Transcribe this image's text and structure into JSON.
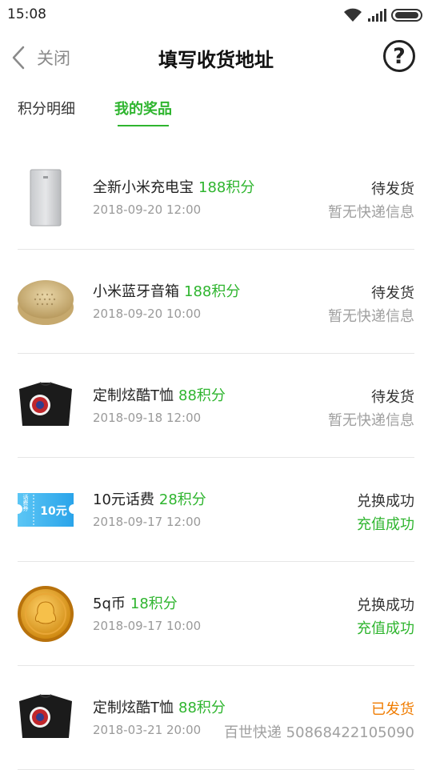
{
  "status_bar": {
    "time": "15:08"
  },
  "nav": {
    "back_label": "关闭",
    "title": "填写收货地址",
    "help_label": "?"
  },
  "tabs": [
    {
      "label": "积分明细"
    },
    {
      "label": "我的奖品"
    }
  ],
  "accent_color": "#2fb52f",
  "prizes": [
    {
      "name": "全新小米充电宝",
      "points": "188积分",
      "date": "2018-09-20 12:00",
      "status": "待发货",
      "detail": "暂无快递信息",
      "icon": "power-bank-icon"
    },
    {
      "name": "小米蓝牙音箱",
      "points": "188积分",
      "date": "2018-09-20 10:00",
      "status": "待发货",
      "detail": "暂无快递信息",
      "icon": "speaker-icon"
    },
    {
      "name": "定制炫酷T恤",
      "points": "88积分",
      "date": "2018-09-18 12:00",
      "status": "待发货",
      "detail": "暂无快递信息",
      "icon": "tshirt-icon"
    },
    {
      "name": "10元话费",
      "points": "28积分",
      "date": "2018-09-17 12:00",
      "status": "兑换成功",
      "detail": "充值成功",
      "icon": "phone-credit-coupon-icon",
      "coupon_text": "话费券",
      "coupon_value": "10元"
    },
    {
      "name": "5q币",
      "points": "18积分",
      "date": "2018-09-17 10:00",
      "status": "兑换成功",
      "detail": "充值成功",
      "icon": "q-coin-icon"
    },
    {
      "name": "定制炫酷T恤",
      "points": "88积分",
      "date": "2018-03-21 20:00",
      "status": "已发货",
      "detail": "百世快递 50868422105090",
      "icon": "tshirt-icon"
    }
  ]
}
